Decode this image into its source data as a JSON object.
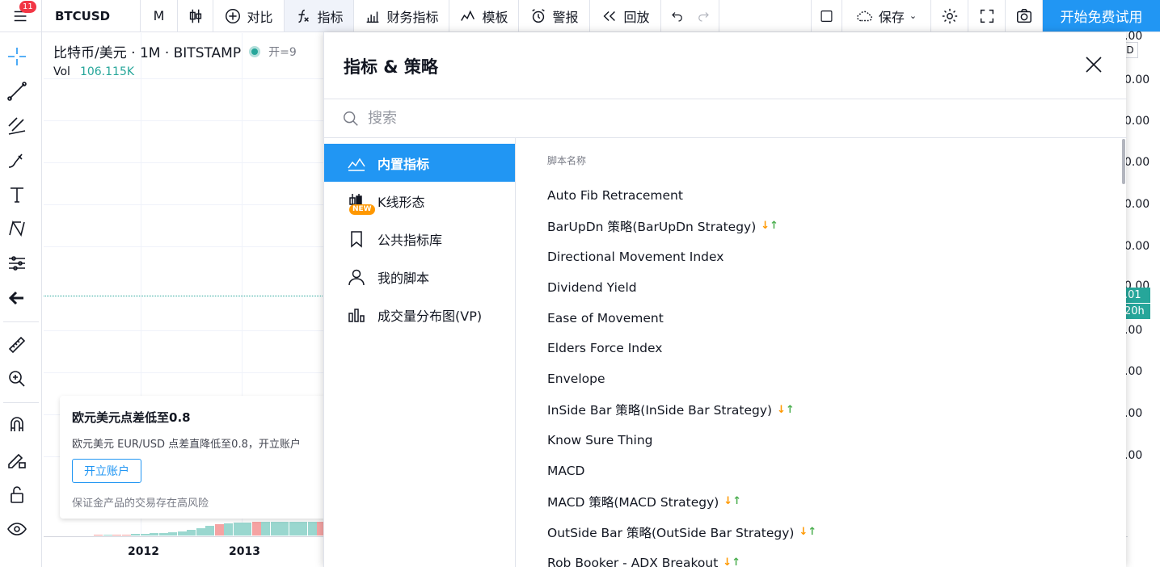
{
  "topbar": {
    "menu_badge": "11",
    "symbol": "BTCUSD",
    "interval": "M",
    "compare": "对比",
    "indicators": "指标",
    "financials": "财务指标",
    "templates": "模板",
    "alerts": "警报",
    "replay": "回放",
    "save": "保存",
    "cta": "开始免费试用"
  },
  "chart": {
    "title": "比特币/美元 · 1M · BITSTAMP",
    "open_label": "开=9",
    "vol_label": "Vol",
    "vol_value": "106.115K",
    "x_labels": [
      "2012",
      "2013"
    ],
    "price_labels": [
      ".00",
      "0.00",
      "0.00",
      "0.00",
      "0.00",
      "0.00",
      "0.00",
      ".00",
      ".00",
      ".00",
      ".00"
    ],
    "price_tag_1": ".01",
    "price_tag_2": "20h",
    "currency": "D"
  },
  "ad": {
    "title": "欧元美元点差低至0.8",
    "desc": "欧元美元 EUR/USD 点差直降低至0.8，开立账户",
    "button": "开立账户",
    "risk": "保证金产品的交易存在高风险"
  },
  "dialog": {
    "title": "指标 & 策略",
    "search_placeholder": "搜索",
    "nav": [
      {
        "label": "内置指标",
        "icon": "chart-wave-icon",
        "new": false
      },
      {
        "label": "K线形态",
        "icon": "candles-icon",
        "new": true,
        "badge": "NEW"
      },
      {
        "label": "公共指标库",
        "icon": "bookmark-icon",
        "new": false
      },
      {
        "label": "我的脚本",
        "icon": "user-icon",
        "new": false
      },
      {
        "label": "成交量分布图(VP)",
        "icon": "volume-profile-icon",
        "new": false
      }
    ],
    "list_header": "脚本名称",
    "scripts": [
      {
        "name": "Auto Fib Retracement",
        "strategy": false
      },
      {
        "name": "BarUpDn 策略(BarUpDn Strategy)",
        "strategy": true
      },
      {
        "name": "Directional Movement Index",
        "strategy": false
      },
      {
        "name": "Dividend Yield",
        "strategy": false
      },
      {
        "name": "Ease of Movement",
        "strategy": false
      },
      {
        "name": "Elders Force Index",
        "strategy": false
      },
      {
        "name": "Envelope",
        "strategy": false
      },
      {
        "name": "InSide Bar 策略(InSide Bar Strategy)",
        "strategy": true
      },
      {
        "name": "Know Sure Thing",
        "strategy": false
      },
      {
        "name": "MACD",
        "strategy": false
      },
      {
        "name": "MACD 策略(MACD Strategy)",
        "strategy": true
      },
      {
        "name": "OutSide Bar 策略(OutSide Bar Strategy)",
        "strategy": true
      },
      {
        "name": "Rob Booker - ADX Breakout",
        "strategy": true
      }
    ],
    "strategy_arrow_down": "↓",
    "strategy_arrow_up": "↑"
  },
  "colors": {
    "accent": "#2196f3",
    "up": "#26a69a",
    "down": "#ef9a9a",
    "badge": "#f23645"
  }
}
